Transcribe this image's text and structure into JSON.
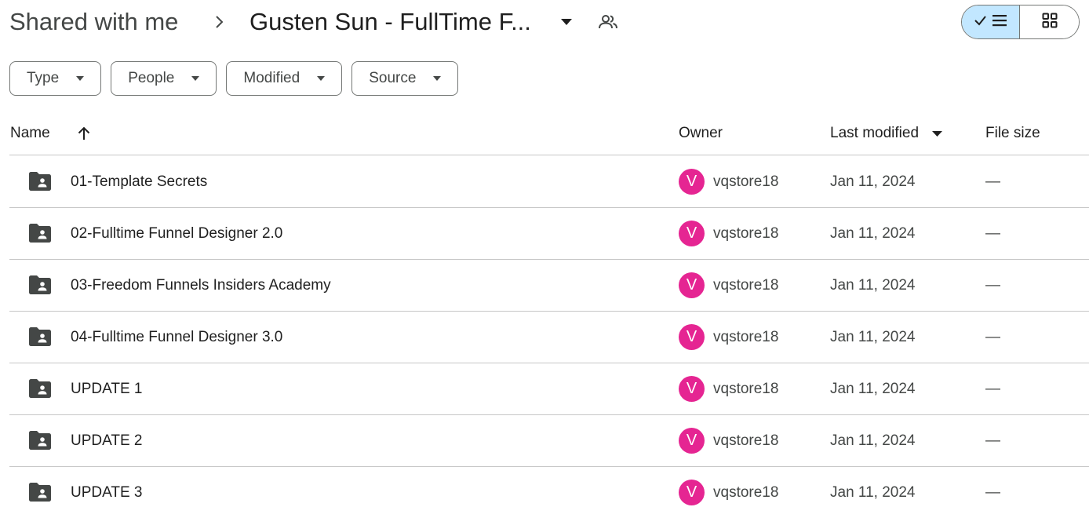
{
  "breadcrumb": {
    "root": "Shared with me",
    "current": "Gusten Sun - FullTime F..."
  },
  "view_toggle": {
    "active": "list"
  },
  "filters": [
    {
      "label": "Type"
    },
    {
      "label": "People"
    },
    {
      "label": "Modified"
    },
    {
      "label": "Source"
    }
  ],
  "table": {
    "headers": {
      "name": "Name",
      "owner": "Owner",
      "modified": "Last modified",
      "size": "File size"
    },
    "rows": [
      {
        "name": "01-Template Secrets",
        "owner_initial": "V",
        "owner": "vqstore18",
        "modified": "Jan 11, 2024",
        "size": "—"
      },
      {
        "name": "02-Fulltime Funnel Designer 2.0",
        "owner_initial": "V",
        "owner": "vqstore18",
        "modified": "Jan 11, 2024",
        "size": "—"
      },
      {
        "name": "03-Freedom Funnels Insiders Academy",
        "owner_initial": "V",
        "owner": "vqstore18",
        "modified": "Jan 11, 2024",
        "size": "—"
      },
      {
        "name": "04-Fulltime Funnel Designer 3.0",
        "owner_initial": "V",
        "owner": "vqstore18",
        "modified": "Jan 11, 2024",
        "size": "—"
      },
      {
        "name": "UPDATE 1",
        "owner_initial": "V",
        "owner": "vqstore18",
        "modified": "Jan 11, 2024",
        "size": "—"
      },
      {
        "name": "UPDATE 2",
        "owner_initial": "V",
        "owner": "vqstore18",
        "modified": "Jan 11, 2024",
        "size": "—"
      },
      {
        "name": "UPDATE 3",
        "owner_initial": "V",
        "owner": "vqstore18",
        "modified": "Jan 11, 2024",
        "size": "—"
      }
    ]
  },
  "icons": {
    "breadcrumb_separator": "chevron-right-icon",
    "dropdown": "caret-down-icon",
    "shared": "people-icon",
    "list_view": "check-list-icon",
    "grid_view": "grid-icon",
    "sort": "arrow-up-icon",
    "folder": "shared-folder-icon"
  },
  "colors": {
    "avatar": "#e52592",
    "active_toggle": "#c2e7ff"
  }
}
